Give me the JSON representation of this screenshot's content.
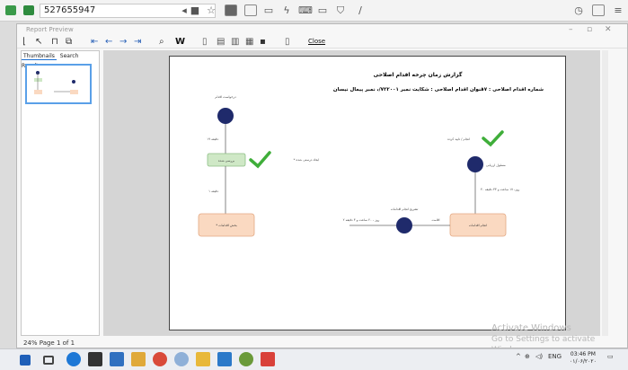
{
  "browser": {
    "address_value": "527655947"
  },
  "window": {
    "title": "Report Preview",
    "close_label": "Close"
  },
  "sidebar": {
    "tabs": [
      "Thumbnails",
      "Search Results"
    ]
  },
  "status_bar": {
    "zoom_page": "24% Page 1 of 1"
  },
  "report": {
    "title": "گزارش زمان چرخه اقدام اصلاحی",
    "action_number": "شماره اقدام اصلاحی :  ۱۷",
    "action_subject": "عنوان اقدام اصلاحی :  شکایت نمبر ۷۲۲۰۰۱/، نمبر پیمال نیسان",
    "left_flow": {
      "top_label": "درخواست اقدام",
      "edge1_label": "۱۹ دقیقه",
      "mid_box": "بررسی شده",
      "mid_side_label": "* ایجاد درستی شده",
      "edge2_label": "۱ دقیقه",
      "bottom_box": "* بخش اقدامات"
    },
    "right_flow": {
      "check_label": "انجام / تایید کرده",
      "circle_label": "مسئول ارزیابی",
      "edge_label": "۴۰ روز، ۱۷ ساعت و ۳۳ دقیقه",
      "box": "انجام اقدامات",
      "h_edge_right_label": "اقامت",
      "h_circle_label": "تشریح انجام اقدامات",
      "h_edge_left_label": "۲ روز ، ۲۰ ساعت و ۳ دقیقه"
    }
  },
  "activation": {
    "line1": "Activate Windows",
    "line2": "Go to Settings to activate Windows."
  },
  "taskbar": {
    "lang": "ENG",
    "time": "03:46 PM",
    "date": "۰۱/۰۶/۲۰۲۰"
  },
  "colors": {
    "node_circle": "#1f2a6b",
    "box_green": "#cfe8c6",
    "box_orange": "#fad9c1",
    "check_green": "#3fae3a",
    "accent_blue": "#2a62b8"
  }
}
